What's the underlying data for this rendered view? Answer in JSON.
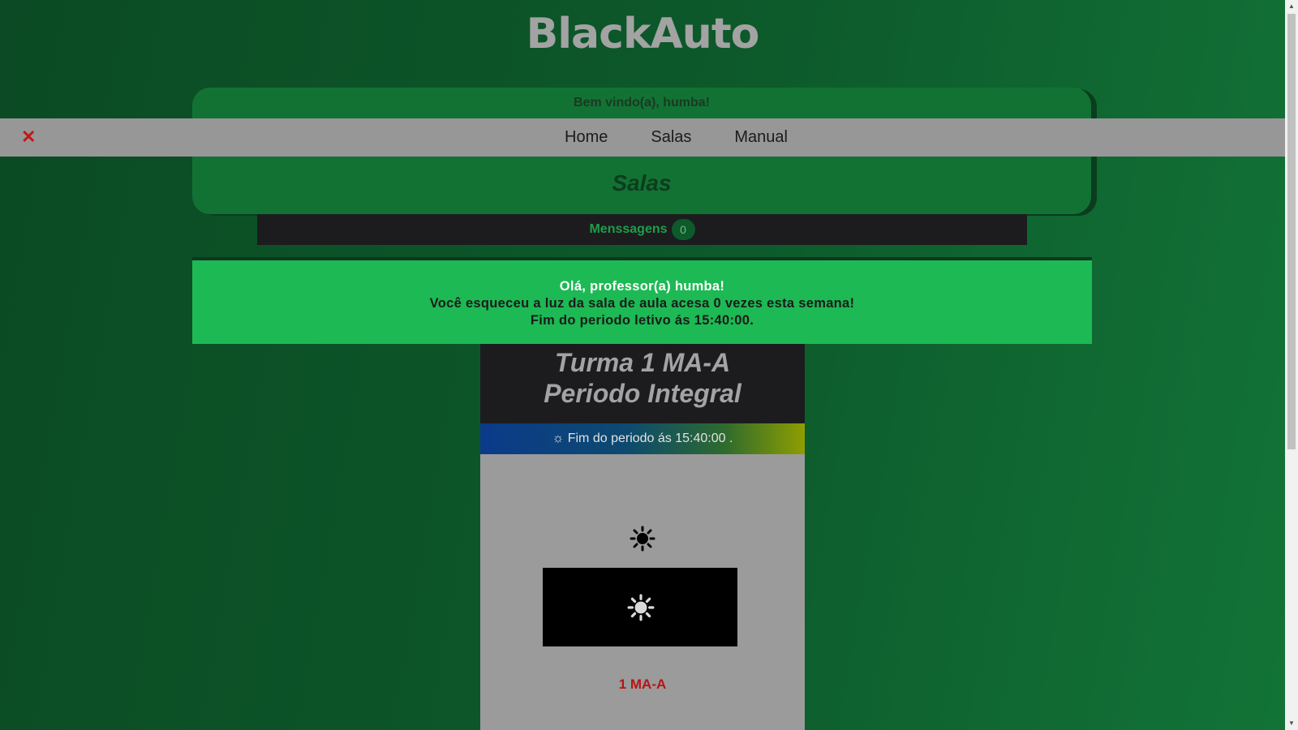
{
  "app": {
    "logo": "BlackAuto"
  },
  "header": {
    "welcome": "Bem vindo(a), humba!",
    "page_heading": "Salas"
  },
  "nav": {
    "close_label": "✕",
    "items": [
      {
        "label": "Home"
      },
      {
        "label": "Salas"
      },
      {
        "label": "Manual"
      }
    ]
  },
  "messages": {
    "label": "Menssagens",
    "count": "0"
  },
  "alert": {
    "greeting": "Olá, professor(a) humba!",
    "line2": "Você esqueceu a luz da sala de aula acesa 0 vezes esta semana!",
    "line3": "Fim do periodo letivo ás 15:40:00."
  },
  "classroom": {
    "title_line1": "Turma 1 MA-A",
    "title_line2": "Periodo Integral",
    "status_icon": "☼",
    "status_text": "Fim do periodo ás 15:40:00 .",
    "indicator_icon": "sun-icon",
    "switch_icon": "sun-icon",
    "room_name": "1 MA-A"
  },
  "colors": {
    "background": "#0d5a2b",
    "accent_green": "#1db954",
    "nav_bg": "#979797",
    "close_red": "#c71616",
    "room_name_red": "#b81414"
  }
}
